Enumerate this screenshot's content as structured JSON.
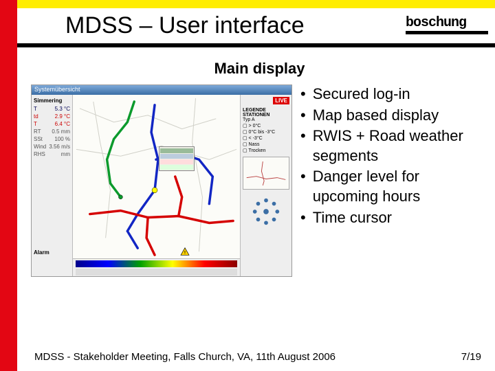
{
  "header": {
    "title": "MDSS – User interface",
    "logo_text": "boschung"
  },
  "subtitle": "Main display",
  "screenshot": {
    "window_title": "Systemübersicht",
    "left_panel": {
      "station": "Simmering",
      "rows": [
        {
          "label": "T",
          "value": "5.3 °C",
          "cls": "blue-t"
        },
        {
          "label": "td",
          "value": "2.9 °C",
          "cls": "red-t"
        },
        {
          "label": "T",
          "value": "6.4 °C",
          "cls": "red-t"
        },
        {
          "label": "RT",
          "value": "0.5 mm",
          "cls": "gray-t"
        },
        {
          "label": "SSt",
          "value": "100 %",
          "cls": "gray-t"
        },
        {
          "label": "Wind",
          "value": "3.56 m/s",
          "cls": "gray-t"
        },
        {
          "label": "RHS",
          "value": "mm",
          "cls": "gray-t"
        }
      ],
      "alarm_label": "Alarm"
    },
    "right_panel": {
      "live_badge": "LIVE",
      "legend_title": "LEGENDE STATIONEN",
      "legend_sub": "Typ A",
      "legend_items": [
        "> 0°C",
        "0°C bis -3°C",
        "< -3°C",
        "Nass",
        "Trocken"
      ]
    }
  },
  "bullets": [
    "Secured log-in",
    "Map based display",
    "RWIS + Road weather segments",
    "Danger level for upcoming hours",
    "Time cursor"
  ],
  "footer": {
    "left": "MDSS - Stakeholder Meeting, Falls Church, VA,  11th August 2006",
    "right": "7/19"
  }
}
